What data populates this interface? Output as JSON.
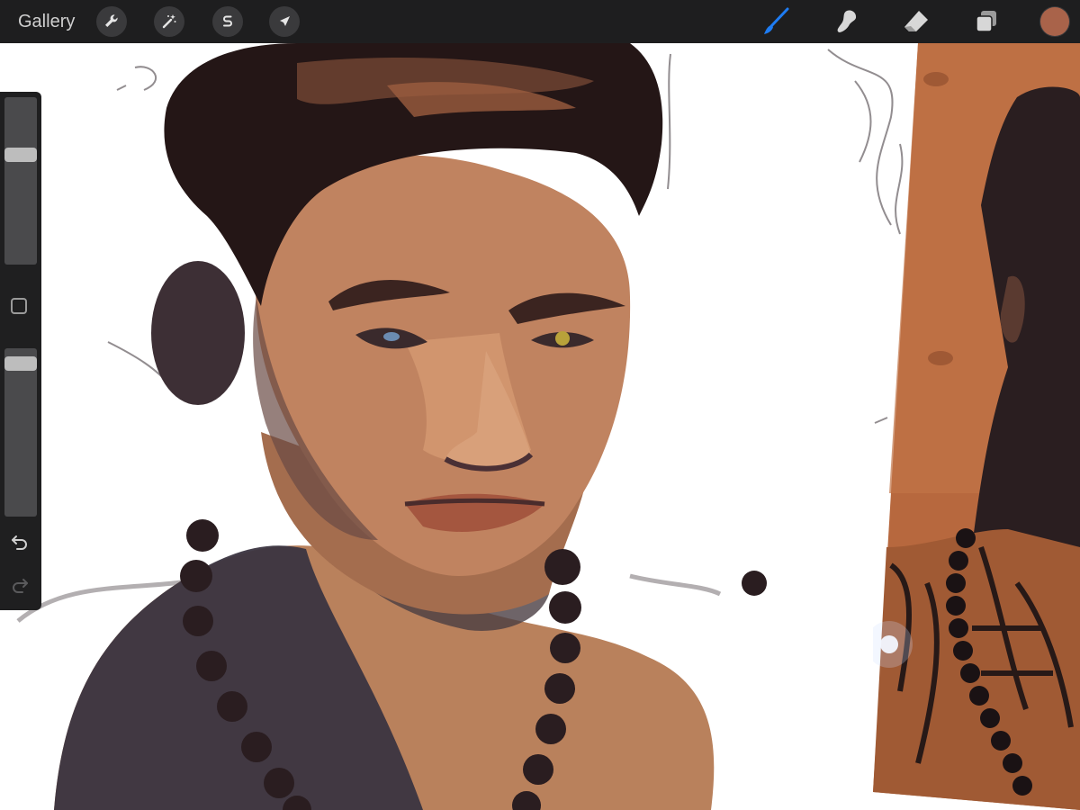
{
  "toolbar": {
    "gallery_label": "Gallery",
    "left_icons": [
      "wrench-icon",
      "magic-wand-icon",
      "selection-s-icon",
      "transform-arrow-icon"
    ],
    "right_tools": [
      "brush-icon",
      "smudge-icon",
      "eraser-icon",
      "layers-icon"
    ],
    "active_tool": "brush-icon",
    "accent_color": "#1e7cf2",
    "current_color": "#a9634a"
  },
  "sidebar": {
    "brush_size_level": 0.2,
    "opacity_level": 0.05,
    "icons": [
      "modify-square-icon",
      "undo-icon",
      "redo-icon"
    ]
  },
  "canvas": {
    "background": "#ffffff",
    "skin_color": "#b97c58",
    "hair_color": "#241616",
    "shadow_color": "#3a3440"
  }
}
